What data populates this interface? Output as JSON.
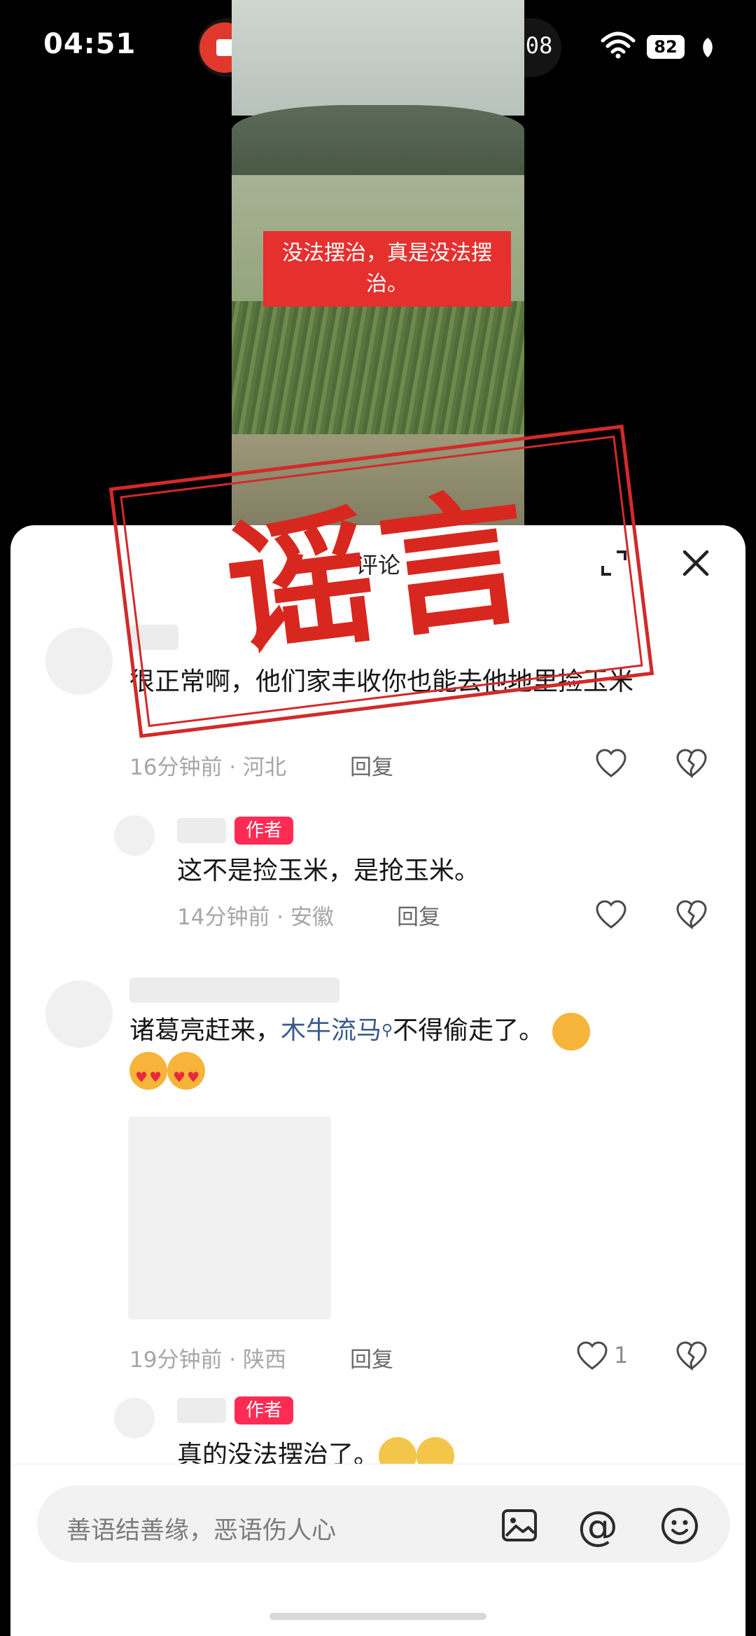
{
  "status_bar": {
    "time": "04:51",
    "recording_time": "00:08",
    "battery": "82"
  },
  "video": {
    "caption": "没法摆治，真是没法摆治。"
  },
  "sheet": {
    "title": "评论"
  },
  "stamp": {
    "text": "谣言"
  },
  "comments": [
    {
      "text": "很正常啊，他们家丰收你也能去他地里捡玉米",
      "time": "16分钟前",
      "location": "河北",
      "reply_label": "回复"
    },
    {
      "badge": "作者",
      "text": "这不是捡玉米，是抢玉米。",
      "time": "14分钟前",
      "location": "安徽",
      "reply_label": "回复"
    },
    {
      "text_before": "诸葛亮赶来，",
      "link": "木牛流马",
      "text_after": "不得偷走了。",
      "time": "19分钟前",
      "location": "陕西",
      "reply_label": "回复",
      "likes": "1"
    },
    {
      "badge": "作者",
      "text": "真的没法摆治了。"
    }
  ],
  "input": {
    "placeholder": "善语结善缘，恶语伤人心"
  },
  "colors": {
    "accent": "#fe2c55",
    "stamp": "#d22a2a",
    "caption_bg": "#e5302e",
    "record": "#e0392c"
  }
}
